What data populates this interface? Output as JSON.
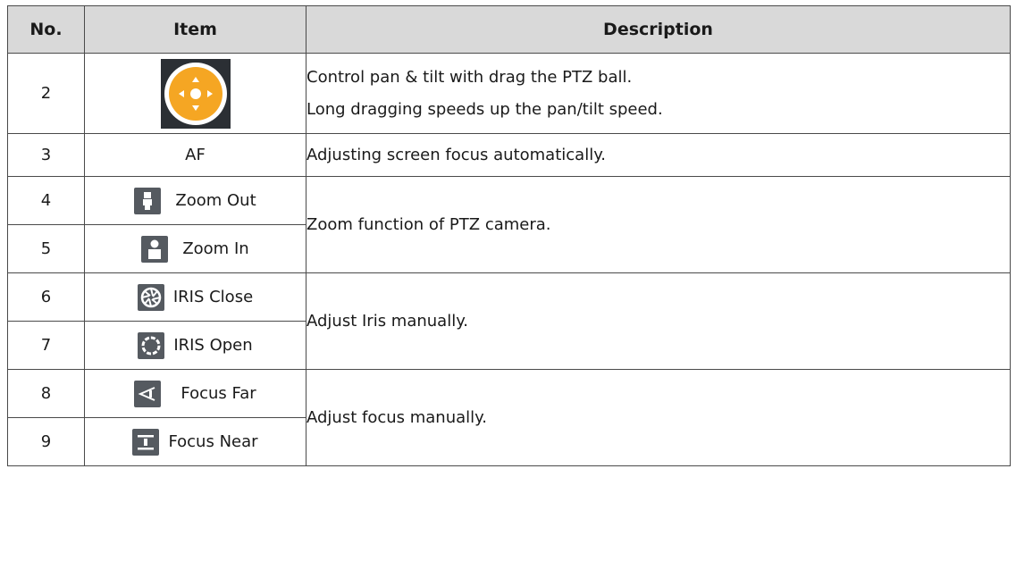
{
  "header": {
    "no": "No.",
    "item": "Item",
    "description": "Description"
  },
  "rows": [
    {
      "no": "2",
      "icon": "ptz-ball-icon",
      "item": "",
      "desc": [
        "Control pan & tilt with drag the PTZ ball.",
        "Long dragging speeds up the pan/tilt speed."
      ]
    },
    {
      "no": "3",
      "icon": "",
      "item": "AF",
      "desc": [
        "Adjusting screen focus automatically."
      ]
    },
    {
      "no": "4",
      "icon": "zoom-out-icon",
      "item": "Zoom Out"
    },
    {
      "no": "5",
      "icon": "zoom-in-icon",
      "item": "Zoom In"
    },
    {
      "no": "6",
      "icon": "iris-close-icon",
      "item": "IRIS Close"
    },
    {
      "no": "7",
      "icon": "iris-open-icon",
      "item": "IRIS Open"
    },
    {
      "no": "8",
      "icon": "focus-far-icon",
      "item": "Focus Far"
    },
    {
      "no": "9",
      "icon": "focus-near-icon",
      "item": "Focus Near"
    }
  ],
  "merged": {
    "zoom": "Zoom function of PTZ camera.",
    "iris": "Adjust Iris manually.",
    "focus": "Adjust focus manually."
  },
  "colors": {
    "header_bg": "#d9d9d9",
    "ptz_orange": "#f5a623",
    "icon_bg": "#555a60"
  }
}
